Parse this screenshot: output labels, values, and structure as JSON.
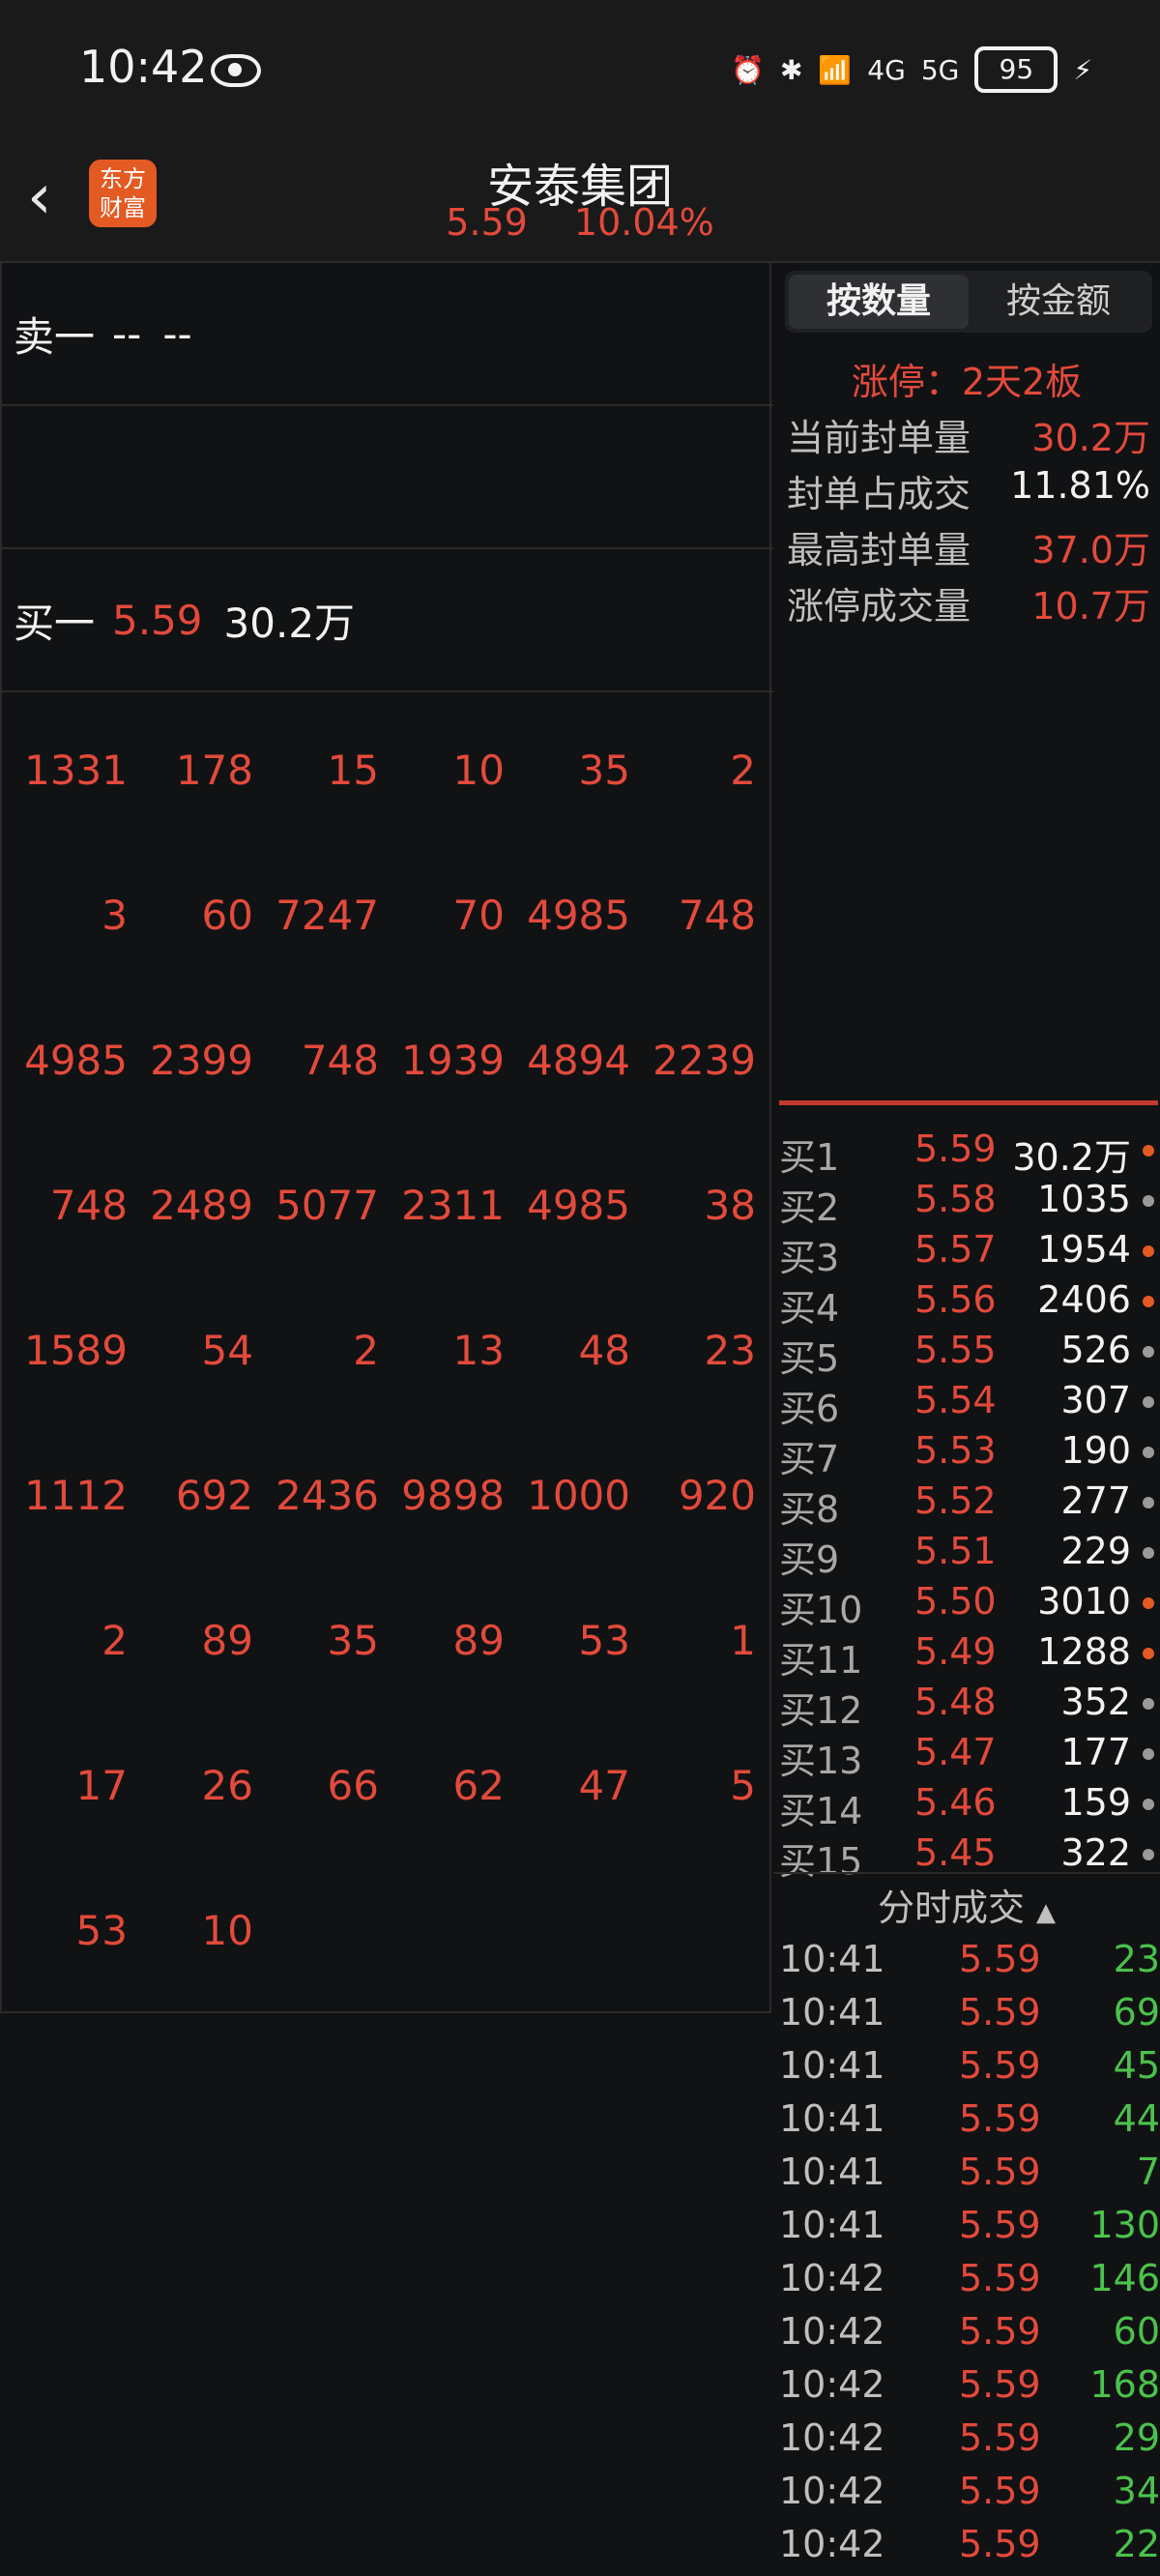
{
  "status_bar": {
    "time": "10:42",
    "signal_labels": [
      "4G",
      "5G"
    ],
    "battery": "95"
  },
  "header": {
    "stock_name": "安泰集团",
    "price": "5.59",
    "change_pct": "10.04%",
    "logo_text": "东方财富"
  },
  "queue": {
    "sell1": {
      "label": "卖一",
      "price": "--",
      "volume": "--"
    },
    "buy1": {
      "label": "买一",
      "price": "5.59",
      "volume": "30.2万"
    }
  },
  "order_grid": [
    [
      "1331",
      "178",
      "15",
      "10",
      "35",
      "2"
    ],
    [
      "3",
      "60",
      "7247",
      "70",
      "4985",
      "748"
    ],
    [
      "4985",
      "2399",
      "748",
      "1939",
      "4894",
      "2239"
    ],
    [
      "748",
      "2489",
      "5077",
      "2311",
      "4985",
      "38"
    ],
    [
      "1589",
      "54",
      "2",
      "13",
      "48",
      "23"
    ],
    [
      "1112",
      "692",
      "2436",
      "9898",
      "1000",
      "920"
    ],
    [
      "2",
      "89",
      "35",
      "89",
      "53",
      "1"
    ],
    [
      "17",
      "26",
      "66",
      "62",
      "47",
      "5"
    ],
    [
      "53",
      "10",
      "",
      "",
      "",
      ""
    ]
  ],
  "toggle": {
    "by_volume": "按数量",
    "by_amount": "按金额"
  },
  "limit": {
    "title": "涨停：2天2板",
    "stats": [
      {
        "key": "当前封单量",
        "value": "30.2万",
        "color": "#e34a3b"
      },
      {
        "key": "封单占成交",
        "value": "11.81%",
        "color": "#f2f2f2"
      },
      {
        "key": "最高封单量",
        "value": "37.0万",
        "color": "#e34a3b"
      },
      {
        "key": "涨停成交量",
        "value": "10.7万",
        "color": "#e34a3b"
      }
    ]
  },
  "order_book": [
    {
      "level": "买1",
      "price": "5.59",
      "volume": "30.2万",
      "dot": "#e35a23"
    },
    {
      "level": "买2",
      "price": "5.58",
      "volume": "1035",
      "dot": "#9a9a9a"
    },
    {
      "level": "买3",
      "price": "5.57",
      "volume": "1954",
      "dot": "#e35a23"
    },
    {
      "level": "买4",
      "price": "5.56",
      "volume": "2406",
      "dot": "#e35a23"
    },
    {
      "level": "买5",
      "price": "5.55",
      "volume": "526",
      "dot": "#9a9a9a"
    },
    {
      "level": "买6",
      "price": "5.54",
      "volume": "307",
      "dot": "#9a9a9a"
    },
    {
      "level": "买7",
      "price": "5.53",
      "volume": "190",
      "dot": "#9a9a9a"
    },
    {
      "level": "买8",
      "price": "5.52",
      "volume": "277",
      "dot": "#9a9a9a"
    },
    {
      "level": "买9",
      "price": "5.51",
      "volume": "229",
      "dot": "#9a9a9a"
    },
    {
      "level": "买10",
      "price": "5.50",
      "volume": "3010",
      "dot": "#e35a23"
    },
    {
      "level": "买11",
      "price": "5.49",
      "volume": "1288",
      "dot": "#e35a23"
    },
    {
      "level": "买12",
      "price": "5.48",
      "volume": "352",
      "dot": "#9a9a9a"
    },
    {
      "level": "买13",
      "price": "5.47",
      "volume": "177",
      "dot": "#9a9a9a"
    },
    {
      "level": "买14",
      "price": "5.46",
      "volume": "159",
      "dot": "#9a9a9a"
    },
    {
      "level": "买15",
      "price": "5.45",
      "volume": "322",
      "dot": "#9a9a9a"
    }
  ],
  "trades_title": "分时成交",
  "trades": [
    {
      "time": "10:41",
      "price": "5.59",
      "qty": "23"
    },
    {
      "time": "10:41",
      "price": "5.59",
      "qty": "69"
    },
    {
      "time": "10:41",
      "price": "5.59",
      "qty": "45"
    },
    {
      "time": "10:41",
      "price": "5.59",
      "qty": "44"
    },
    {
      "time": "10:41",
      "price": "5.59",
      "qty": "7"
    },
    {
      "time": "10:41",
      "price": "5.59",
      "qty": "130"
    },
    {
      "time": "10:42",
      "price": "5.59",
      "qty": "146"
    },
    {
      "time": "10:42",
      "price": "5.59",
      "qty": "60"
    },
    {
      "time": "10:42",
      "price": "5.59",
      "qty": "168"
    },
    {
      "time": "10:42",
      "price": "5.59",
      "qty": "29"
    },
    {
      "time": "10:42",
      "price": "5.59",
      "qty": "34"
    },
    {
      "time": "10:42",
      "price": "5.59",
      "qty": "22"
    }
  ]
}
